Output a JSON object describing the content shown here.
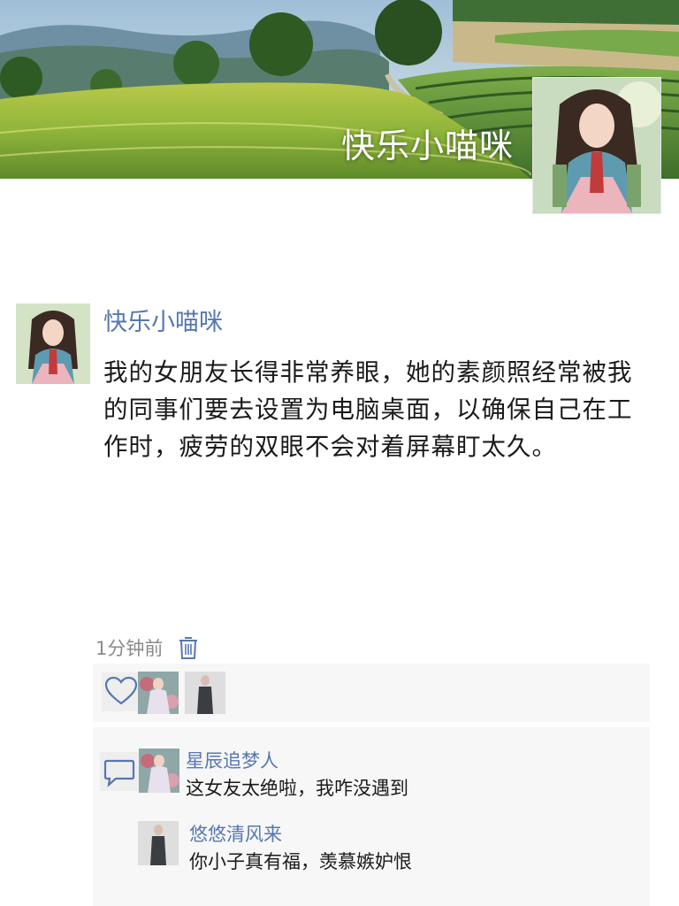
{
  "cover": {
    "title": "快乐小喵咪",
    "avatar_icon": "woman-in-hanbok-avatar"
  },
  "post": {
    "author": "快乐小喵咪",
    "text": "我的女朋友长得非常养眼，她的素颜照经常被我的同事们要去设置为电脑桌面，以确保自己在工作时，疲劳的双眼不会对着屏幕盯太久。",
    "time": "1分钟前",
    "delete_icon": "trash-icon"
  },
  "likes": {
    "icon": "heart-icon",
    "users": [
      "avatar-floral-dress",
      "avatar-dark-suit"
    ]
  },
  "comments": {
    "icon": "comment-icon",
    "items": [
      {
        "name": "星辰追梦人",
        "text": "这女友太绝啦，我咋没遇到"
      },
      {
        "name": "悠悠清风来",
        "text": "你小子真有福，羡慕嫉妒恨"
      }
    ]
  },
  "colors": {
    "link_blue": "#5677b0",
    "panel_bg": "#f7f7f7",
    "muted_text": "#8a8a8a"
  }
}
